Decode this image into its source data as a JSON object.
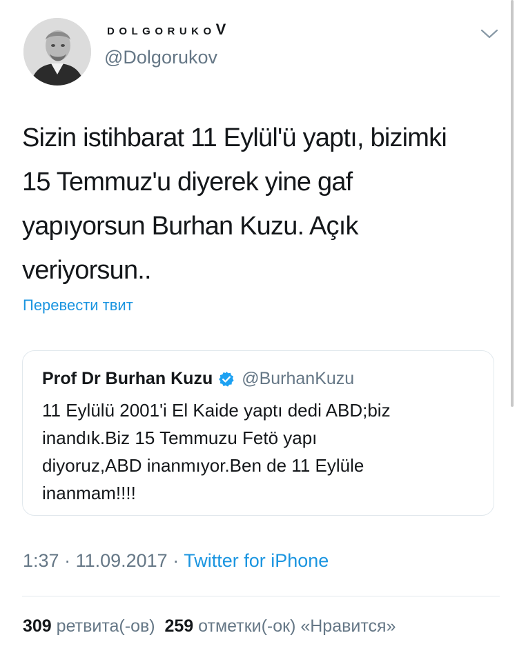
{
  "author": {
    "display_name_main": "DOLGORUKO",
    "display_name_last": "V",
    "handle": "@Dolgorukov",
    "avatar_icon": "portrait-avatar-icon"
  },
  "tweet": {
    "text": "Sizin istihbarat 11 Eylül'ü yaptı, bizimki\n15 Temmuz'u diyerek yine gaf\nyapıyorsun Burhan Kuzu. Açık\nveriyorsun..",
    "translate_label": "Перевести твит"
  },
  "quote": {
    "name": "Prof Dr Burhan Kuzu",
    "handle": "@BurhanKuzu",
    "verified_color": "#1da1f2",
    "text": "11 Eylülü 2001'i El Kaide yaptı dedi ABD;biz\ninandık.Biz 15 Temmuzu Fetö yapı\ndiyoruz,ABD inanmıyor.Ben de 11 Eylüle\ninanmam!!!!"
  },
  "meta": {
    "time": "1:37",
    "separator1": " · ",
    "date": "11.09.2017",
    "separator2": " · ",
    "source": "Twitter for iPhone"
  },
  "stats": {
    "retweets_count": "309",
    "retweets_label": "ретвита(-ов)",
    "likes_count": "259",
    "likes_label": "отметки(-ок) «Нравится»"
  },
  "colors": {
    "link": "#1b95e0",
    "secondary_text": "#657786",
    "primary_text": "#14171a",
    "border": "#e1e8ed"
  }
}
